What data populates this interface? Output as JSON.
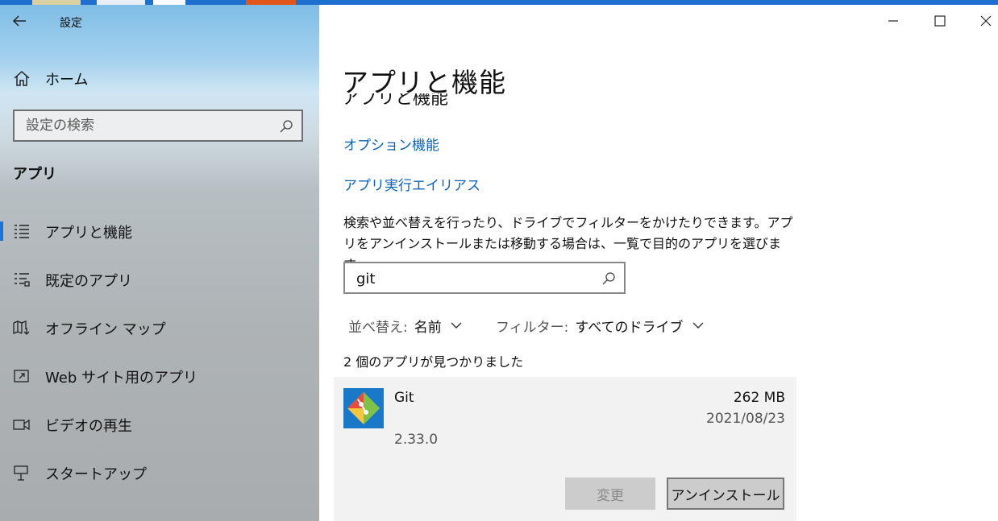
{
  "window": {
    "title": "設定",
    "controls": {
      "minimize_icon": "minimize-icon",
      "maximize_icon": "maximize-icon",
      "close_icon": "close-icon"
    }
  },
  "sidebar": {
    "home_label": "ホーム",
    "search_placeholder": "設定の検索",
    "section_title": "アプリ",
    "items": [
      {
        "label": "アプリと機能",
        "icon": "apps-features-icon",
        "selected": true
      },
      {
        "label": "既定のアプリ",
        "icon": "default-apps-icon",
        "selected": false
      },
      {
        "label": "オフライン マップ",
        "icon": "offline-maps-icon",
        "selected": false
      },
      {
        "label": "Web サイト用のアプリ",
        "icon": "apps-for-websites-icon",
        "selected": false
      },
      {
        "label": "ビデオの再生",
        "icon": "video-playback-icon",
        "selected": false
      },
      {
        "label": "スタートアップ",
        "icon": "startup-icon",
        "selected": false
      }
    ]
  },
  "main": {
    "page_title": "アプリと機能",
    "clipped_heading": "アプリと機能",
    "links": {
      "optional_features": "オプション機能",
      "app_execution_aliases": "アプリ実行エイリアス"
    },
    "description": "検索や並べ替えを行ったり、ドライブでフィルターをかけたりできます。アプリをアンインストールまたは移動する場合は、一覧で目的のアプリを選びます。",
    "search_value": "git",
    "sort": {
      "label": "並べ替え:",
      "value": "名前"
    },
    "filter": {
      "label": "フィルター:",
      "value": "すべてのドライブ"
    },
    "result_count_text": "2 個のアプリが見つかりました",
    "apps": [
      {
        "name": "Git",
        "size": "262 MB",
        "date": "2021/08/23",
        "version": "2.33.0",
        "modify_label": "変更",
        "uninstall_label": "アンインストール"
      }
    ]
  },
  "colors": {
    "accent": "#1a73d9",
    "link": "#0b63b8",
    "card_bg": "#f2f2f2"
  }
}
